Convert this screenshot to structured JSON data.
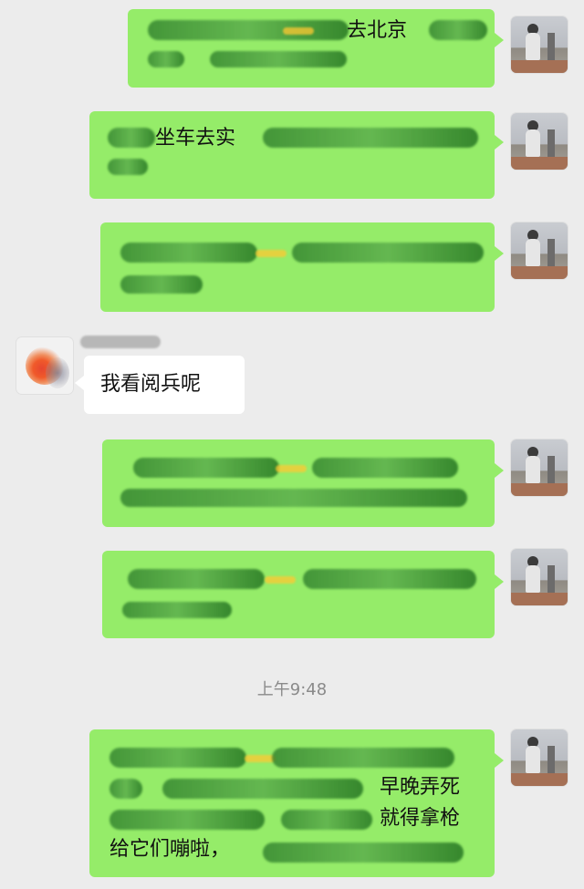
{
  "chat": {
    "messages": [
      {
        "side": "right",
        "visible_text": "去北京"
      },
      {
        "side": "right",
        "visible_text": "坐车去实"
      },
      {
        "side": "right",
        "visible_text": ""
      },
      {
        "side": "left",
        "visible_text": "我看阅兵呢"
      },
      {
        "side": "right",
        "visible_text": ""
      },
      {
        "side": "right",
        "visible_text": ""
      },
      {
        "side": "right",
        "visible_text_lines": [
          "早晚弄死",
          "就得拿枪",
          "给它们嘣啦，"
        ]
      }
    ],
    "timestamp": "上午9:48"
  },
  "colors": {
    "background": "#ececec",
    "outgoing_bubble": "#95ec69",
    "incoming_bubble": "#ffffff"
  }
}
